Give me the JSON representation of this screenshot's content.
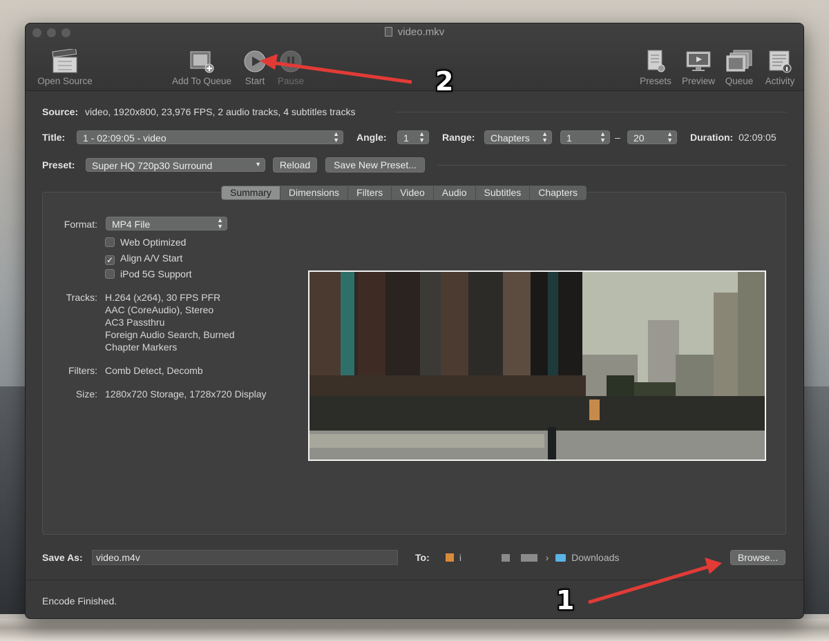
{
  "window": {
    "title": "video.mkv"
  },
  "toolbar": {
    "open_source": "Open Source",
    "add_to_queue": "Add To Queue",
    "start": "Start",
    "pause": "Pause",
    "presets": "Presets",
    "preview": "Preview",
    "queue": "Queue",
    "activity": "Activity"
  },
  "source": {
    "label": "Source:",
    "value": "video, 1920x800, 23,976 FPS, 2 audio tracks, 4 subtitles tracks"
  },
  "title_row": {
    "title_label": "Title:",
    "title_value": "1 - 02:09:05 - video",
    "angle_label": "Angle:",
    "angle_value": "1",
    "range_label": "Range:",
    "range_type": "Chapters",
    "range_start": "1",
    "range_dash": "–",
    "range_end": "20",
    "duration_label": "Duration:",
    "duration_value": "02:09:05"
  },
  "preset_row": {
    "label": "Preset:",
    "value": "Super HQ 720p30 Surround",
    "reload": "Reload",
    "save_new": "Save New Preset..."
  },
  "tabs": [
    "Summary",
    "Dimensions",
    "Filters",
    "Video",
    "Audio",
    "Subtitles",
    "Chapters"
  ],
  "summary": {
    "format_label": "Format:",
    "format_value": "MP4 File",
    "options": [
      {
        "label": "Web Optimized",
        "checked": false
      },
      {
        "label": "Align A/V Start",
        "checked": true
      },
      {
        "label": "iPod 5G Support",
        "checked": false
      }
    ],
    "tracks_label": "Tracks:",
    "tracks": [
      "H.264 (x264), 30 FPS PFR",
      "AAC (CoreAudio), Stereo",
      "AC3 Passthru",
      "Foreign Audio Search, Burned",
      "Chapter Markers"
    ],
    "filters_label": "Filters:",
    "filters_value": "Comb Detect, Decomb",
    "size_label": "Size:",
    "size_value": "1280x720 Storage, 1728x720 Display"
  },
  "output": {
    "save_as_label": "Save As:",
    "save_as_value": "video.m4v",
    "to_label": "To:",
    "path_user": "i",
    "path_separator": "›",
    "path_folder": "Downloads",
    "browse": "Browse..."
  },
  "status": {
    "text": "Encode Finished."
  },
  "annotations": {
    "step1": "1",
    "step2": "2",
    "arrow_color": "#e23b36"
  }
}
